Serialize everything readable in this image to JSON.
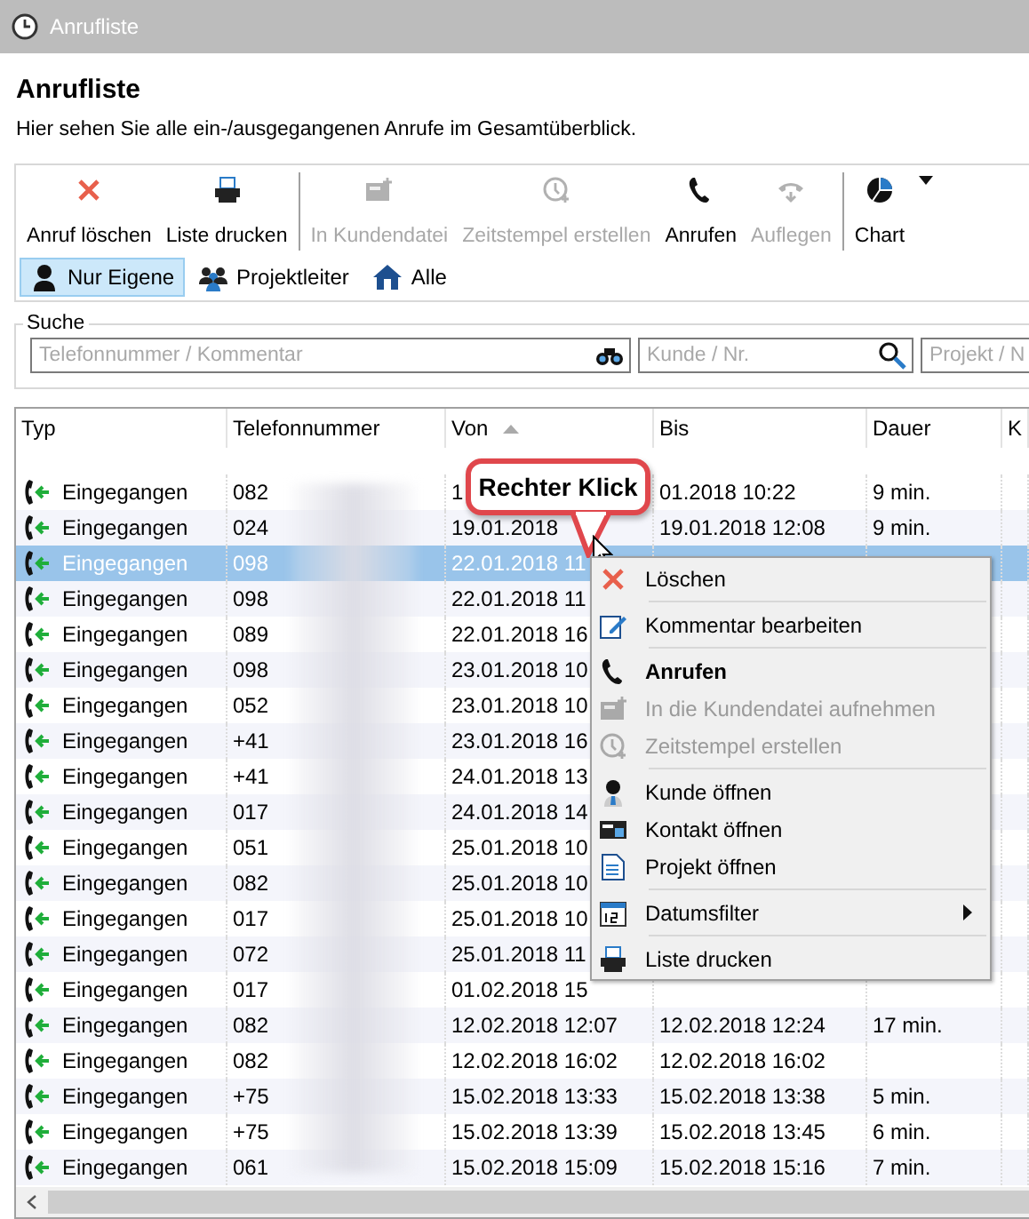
{
  "window": {
    "title": "Anrufliste"
  },
  "header": {
    "title": "Anrufliste",
    "subtitle": "Hier sehen Sie alle ein-/ausgegangenen Anrufe im Gesamtüberblick."
  },
  "toolbar": [
    [
      {
        "label": "Anruf löschen",
        "disabled": false
      },
      {
        "label": "Liste drucken",
        "disabled": false
      }
    ],
    [
      {
        "label": "In Kundendatei",
        "disabled": true
      },
      {
        "label": "Zeitstempel erstellen",
        "disabled": true
      },
      {
        "label": "Anrufen",
        "disabled": false
      },
      {
        "label": "Auflegen",
        "disabled": true
      }
    ],
    [
      {
        "label": "Chart",
        "disabled": false,
        "dropdown": true
      }
    ]
  ],
  "filters": [
    {
      "label": "Nur Eigene",
      "selected": true
    },
    {
      "label": "Projektleiter",
      "selected": false
    },
    {
      "label": "Alle",
      "selected": false
    }
  ],
  "search": {
    "label": "Suche",
    "fields": [
      {
        "placeholder": "Telefonnummer / Kommentar"
      },
      {
        "placeholder": "Kunde / Nr."
      },
      {
        "placeholder": "Projekt / N"
      }
    ]
  },
  "table": {
    "columns": [
      "Typ",
      "Telefonnummer",
      "Von",
      "Bis",
      "Dauer",
      "K"
    ],
    "rows": [
      {
        "type": "Eingegangen",
        "phone": "082",
        "from": "1",
        "to": "01.2018 10:22",
        "duration": "9 min.",
        "selected": false
      },
      {
        "type": "Eingegangen",
        "phone": "024",
        "from": "19.01.2018",
        "to": "19.01.2018 12:08",
        "duration": "9 min.",
        "selected": false
      },
      {
        "type": "Eingegangen",
        "phone": "098",
        "from": "22.01.2018 11",
        "to": "",
        "duration": "",
        "selected": true
      },
      {
        "type": "Eingegangen",
        "phone": "098",
        "from": "22.01.2018 11",
        "to": "",
        "duration": "",
        "selected": false
      },
      {
        "type": "Eingegangen",
        "phone": "089",
        "from": "22.01.2018 16",
        "to": "",
        "duration": "",
        "selected": false
      },
      {
        "type": "Eingegangen",
        "phone": "098",
        "from": "23.01.2018 10",
        "to": "",
        "duration": "",
        "selected": false
      },
      {
        "type": "Eingegangen",
        "phone": "052",
        "from": "23.01.2018 10",
        "to": "",
        "duration": "",
        "selected": false
      },
      {
        "type": "Eingegangen",
        "phone": "+41",
        "from": "23.01.2018 16",
        "to": "",
        "duration": "",
        "selected": false
      },
      {
        "type": "Eingegangen",
        "phone": "+41",
        "from": "24.01.2018 13",
        "to": "",
        "duration": "",
        "selected": false
      },
      {
        "type": "Eingegangen",
        "phone": "017",
        "from": "24.01.2018 14",
        "to": "",
        "duration": "",
        "selected": false
      },
      {
        "type": "Eingegangen",
        "phone": "051",
        "from": "25.01.2018 10",
        "to": "",
        "duration": "",
        "selected": false
      },
      {
        "type": "Eingegangen",
        "phone": "082",
        "from": "25.01.2018 10",
        "to": "",
        "duration": "",
        "selected": false
      },
      {
        "type": "Eingegangen",
        "phone": "017",
        "from": "25.01.2018 10",
        "to": "",
        "duration": "",
        "selected": false
      },
      {
        "type": "Eingegangen",
        "phone": "072",
        "from": "25.01.2018 11",
        "to": "",
        "duration": "",
        "selected": false
      },
      {
        "type": "Eingegangen",
        "phone": "017",
        "from": "01.02.2018 15",
        "to": "",
        "duration": "",
        "selected": false
      },
      {
        "type": "Eingegangen",
        "phone": "082",
        "from": "12.02.2018 12:07",
        "to": "12.02.2018 12:24",
        "duration": "17 min.",
        "selected": false
      },
      {
        "type": "Eingegangen",
        "phone": "082",
        "from": "12.02.2018 16:02",
        "to": "12.02.2018 16:02",
        "duration": "",
        "selected": false
      },
      {
        "type": "Eingegangen",
        "phone": "+75",
        "from": "15.02.2018 13:33",
        "to": "15.02.2018 13:38",
        "duration": "5 min.",
        "selected": false
      },
      {
        "type": "Eingegangen",
        "phone": "+75",
        "from": "15.02.2018 13:39",
        "to": "15.02.2018 13:45",
        "duration": "6 min.",
        "selected": false
      },
      {
        "type": "Eingegangen",
        "phone": "061",
        "from": "15.02.2018 15:09",
        "to": "15.02.2018 15:16",
        "duration": "7 min.",
        "selected": false
      }
    ]
  },
  "callout": {
    "text": "Rechter Klick"
  },
  "context_menu": [
    [
      {
        "label": "Löschen",
        "disabled": false
      }
    ],
    [
      {
        "label": "Kommentar bearbeiten",
        "disabled": false
      }
    ],
    [
      {
        "label": "Anrufen",
        "disabled": false,
        "default": true
      },
      {
        "label": "In die Kundendatei aufnehmen",
        "disabled": true
      },
      {
        "label": "Zeitstempel erstellen",
        "disabled": true
      }
    ],
    [
      {
        "label": "Kunde öffnen",
        "disabled": false
      },
      {
        "label": "Kontakt öffnen",
        "disabled": false
      },
      {
        "label": "Projekt öffnen",
        "disabled": false
      }
    ],
    [
      {
        "label": "Datumsfilter",
        "disabled": false,
        "submenu": true
      }
    ],
    [
      {
        "label": "Liste drucken",
        "disabled": false
      }
    ]
  ]
}
